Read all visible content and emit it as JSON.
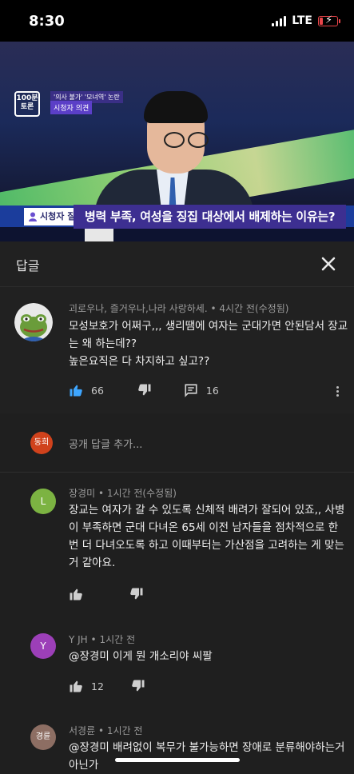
{
  "status_bar": {
    "time": "8:30",
    "network": "LTE"
  },
  "video": {
    "logo": "100분\n토론",
    "topic_tag": "'의사 불가' '모녀역' 논란",
    "sub_tag": "시청자 의견",
    "caption_label": "시청자 질문",
    "caption_text": "병력 부족, 여성을 징집 대상에서 배제하는 이유는?"
  },
  "header": {
    "title": "답글",
    "close_icon": "close-icon"
  },
  "parent_comment": {
    "author": "괴로우나, 즐거우나,나라 사랑하세.",
    "time": "4시간 전(수정됨)",
    "lines": [
      "모성보호가 어쩌구,,, 생리땜에 여자는 군대가면 안된담서 장교",
      "는 왜 하는데??",
      "높은요직은 다 차지하고 싶고??"
    ],
    "likes": "66",
    "replies": "16"
  },
  "reply_box": {
    "avatar_text": "동희",
    "placeholder": "공개 답글 추가..."
  },
  "replies": [
    {
      "avatar_text": "L",
      "avatar_color": "#7cb342",
      "author": "장경미",
      "time": "1시간 전(수정됨)",
      "lines": [
        "장교는 여자가 갈 수 있도록 신체적 배려가 잘되어 있죠,, 사병",
        "이 부족하면 군대 다녀온 65세 이전 남자들을 점차적으로 한",
        "번 더 다녀오도록 하고 이때부터는 가산점을 고려하는 게 맞는",
        "거 같아요."
      ],
      "likes": ""
    },
    {
      "avatar_text": "Y",
      "avatar_color": "#9c3fb8",
      "author": "Y JH",
      "time": "1시간 전",
      "lines": [
        "@장경미 이게 뭔 개소리야 씨팔"
      ],
      "likes": "12"
    },
    {
      "avatar_text": "경륜",
      "avatar_color": "#8d6e63",
      "author": "서경륜",
      "time": "1시간 전",
      "lines": [
        "@장경미 배려없이 복무가 불가능하면 장애로 분류해야하는거",
        "아닌가"
      ],
      "likes": ""
    }
  ],
  "separator": "•"
}
